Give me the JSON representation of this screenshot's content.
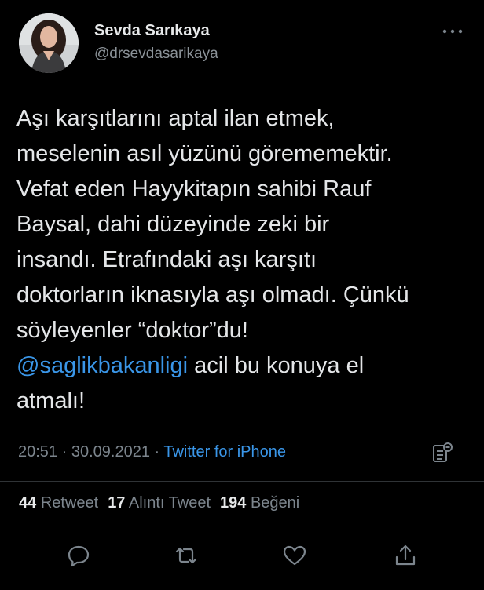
{
  "user": {
    "display_name": "Sevda Sarıkaya",
    "handle": "@drsevdasarikaya"
  },
  "tweet": {
    "lines": [
      "Aşı karşıtlarını aptal ilan etmek,",
      "meselenin asıl yüzünü görememektir.",
      "Vefat eden Hayykitapın sahibi Rauf",
      "Baysal, dahi düzeyinde zeki bir",
      "insandı. Etrafındaki aşı karşıtı",
      "doktorların iknasıyla aşı olmadı. Çünkü",
      "söyleyenler “doktor”du!"
    ],
    "mention": "@saglikbakanligi",
    "after_mention": " acil bu konuya el",
    "last_line": "atmalı!"
  },
  "meta": {
    "time": "20:51",
    "separator": " · ",
    "date": "30.09.2021",
    "source": "Twitter for iPhone"
  },
  "stats": {
    "retweets_count": "44",
    "retweets_label": "Retweet",
    "quotes_count": "17",
    "quotes_label": "Alıntı Tweet",
    "likes_count": "194",
    "likes_label": "Beğeni"
  },
  "icons": {
    "more": "more-horizontal-icon",
    "analytics": "analytics-icon",
    "reply": "reply-icon",
    "retweet": "retweet-icon",
    "like": "heart-icon",
    "share": "share-icon"
  },
  "colors": {
    "background": "#000000",
    "text": "#e7e9ea",
    "secondary": "#7c858d",
    "link": "#3a96e8",
    "divider": "#2f3336"
  }
}
